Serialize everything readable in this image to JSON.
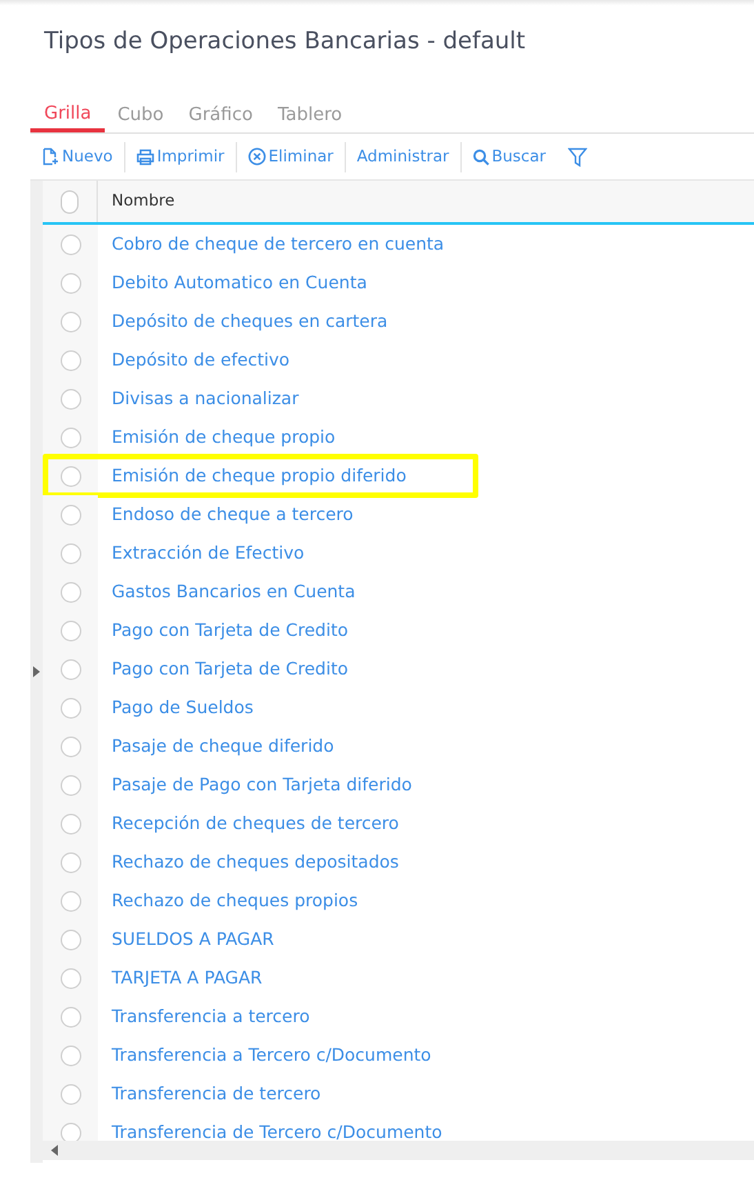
{
  "window": {
    "title": "Tipos de Operaciones Bancarias - default"
  },
  "tabs": [
    {
      "label": "Grilla",
      "selected": true
    },
    {
      "label": "Cubo",
      "selected": false
    },
    {
      "label": "Gráfico",
      "selected": false
    },
    {
      "label": "Tablero",
      "selected": false
    }
  ],
  "toolbar": [
    {
      "kind": "new",
      "label": "Nuevo"
    },
    {
      "kind": "print",
      "label": "Imprimir"
    },
    {
      "kind": "delete",
      "label": "Eliminar"
    },
    {
      "kind": "plain",
      "label": "Administrar"
    },
    {
      "kind": "search",
      "label": "Buscar"
    },
    {
      "kind": "filter"
    }
  ],
  "table": {
    "all_selected": false,
    "columns": [
      "Nombre"
    ],
    "rows": [
      {
        "name": "Cobro de cheque de tercero en cuenta",
        "selected": false,
        "highlighted": false
      },
      {
        "name": "Debito Automatico en Cuenta",
        "selected": false,
        "highlighted": false
      },
      {
        "name": "Depósito de cheques en cartera",
        "selected": false,
        "highlighted": false
      },
      {
        "name": "Depósito de efectivo",
        "selected": false,
        "highlighted": false
      },
      {
        "name": "Divisas a nacionalizar",
        "selected": false,
        "highlighted": false
      },
      {
        "name": "Emisión de cheque propio",
        "selected": false,
        "highlighted": false
      },
      {
        "name": "Emisión de cheque propio diferido",
        "selected": false,
        "highlighted": true
      },
      {
        "name": "Endoso de cheque a tercero",
        "selected": false,
        "highlighted": false
      },
      {
        "name": "Extracción de Efectivo",
        "selected": false,
        "highlighted": false
      },
      {
        "name": "Gastos Bancarios en Cuenta",
        "selected": false,
        "highlighted": false
      },
      {
        "name": "Pago con Tarjeta de Credito",
        "selected": false,
        "highlighted": false
      },
      {
        "name": "Pago con Tarjeta de Credito",
        "selected": false,
        "highlighted": false
      },
      {
        "name": "Pago de Sueldos",
        "selected": false,
        "highlighted": false
      },
      {
        "name": "Pasaje de cheque diferido",
        "selected": false,
        "highlighted": false
      },
      {
        "name": "Pasaje de Pago con Tarjeta diferido",
        "selected": false,
        "highlighted": false
      },
      {
        "name": "Recepción de cheques de tercero",
        "selected": false,
        "highlighted": false
      },
      {
        "name": "Rechazo de cheques depositados",
        "selected": false,
        "highlighted": false
      },
      {
        "name": "Rechazo de cheques propios",
        "selected": false,
        "highlighted": false
      },
      {
        "name": "SUELDOS A PAGAR",
        "selected": false,
        "highlighted": false
      },
      {
        "name": "TARJETA A PAGAR",
        "selected": false,
        "highlighted": false
      },
      {
        "name": "Transferencia a tercero",
        "selected": false,
        "highlighted": false
      },
      {
        "name": "Transferencia a Tercero c/Documento",
        "selected": false,
        "highlighted": false
      },
      {
        "name": "Transferencia de tercero",
        "selected": false,
        "highlighted": false
      },
      {
        "name": "Transferencia de Tercero c/Documento",
        "selected": false,
        "highlighted": false
      }
    ]
  }
}
